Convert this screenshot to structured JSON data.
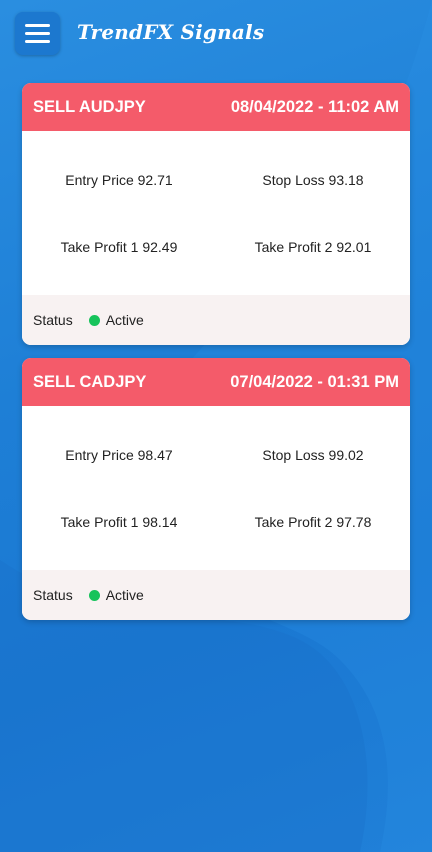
{
  "app": {
    "title": "TrendFX Signals"
  },
  "signals": [
    {
      "pair": "SELL AUDJPY",
      "datetime": "08/04/2022 - 11:02 AM",
      "entry": "Entry Price 92.71",
      "stop_loss": "Stop Loss 93.18",
      "tp1": "Take Profit 1 92.49",
      "tp2": "Take Profit 2 92.01",
      "status_label": "Status",
      "status_value": "Active"
    },
    {
      "pair": "SELL CADJPY",
      "datetime": "07/04/2022 - 01:31 PM",
      "entry": "Entry Price 98.47",
      "stop_loss": "Stop Loss 99.02",
      "tp1": "Take Profit 1 98.14",
      "tp2": "Take Profit 2 97.78",
      "status_label": "Status",
      "status_value": "Active"
    }
  ],
  "colors": {
    "header": "#f45b6a",
    "active": "#17c35b",
    "background": "#1e7fd6"
  }
}
